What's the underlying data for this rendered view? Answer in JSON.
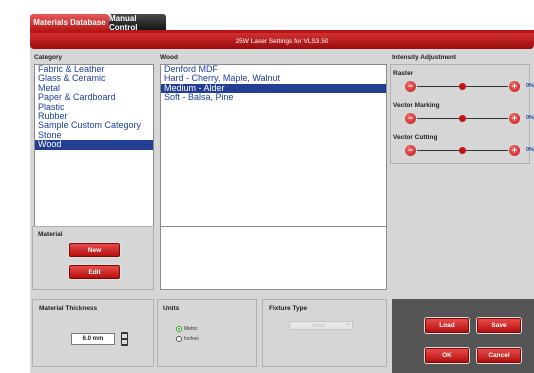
{
  "tabs": [
    "Materials Database",
    "Manual Control"
  ],
  "title": "25W Laser Settings for VLS3.50",
  "category": {
    "label": "Category",
    "items": [
      "Fabric & Leather",
      "Glass & Ceramic",
      "Metal",
      "Paper & Cardboard",
      "Plastic",
      "Rubber",
      "Sample Custom Category",
      "Stone",
      "Wood"
    ],
    "selected_index": 8
  },
  "wood": {
    "label": "Wood",
    "items": [
      "Denford MDF",
      "Hard - Cherry, Maple, Walnut",
      "Medium - Alder",
      "Soft - Balsa, Pine"
    ],
    "selected_index": 2
  },
  "intensity": {
    "label": "Intensity Adjustment",
    "sliders": [
      {
        "label": "Raster",
        "value": "0%",
        "level": 0.5
      },
      {
        "label": "Vector Marking",
        "value": "0%",
        "level": 0.5
      },
      {
        "label": "Vector Cutting",
        "value": "0%",
        "level": 0.5
      }
    ]
  },
  "material": {
    "label": "Material",
    "new_label": "New",
    "edit_label": "Edit"
  },
  "thickness": {
    "label": "Material Thickness",
    "value": "6.0 mm"
  },
  "units": {
    "label": "Units",
    "options": [
      "Metric",
      "Inches"
    ],
    "selected": "Metric"
  },
  "fixture": {
    "label": "Fixture Type",
    "value": "NONE"
  },
  "actions": {
    "load": "Load",
    "save": "Save",
    "ok": "OK",
    "cancel": "Cancel"
  },
  "colors": {
    "accent": "#b81616",
    "selection": "#223f93",
    "list_text": "#1c3fa0"
  }
}
